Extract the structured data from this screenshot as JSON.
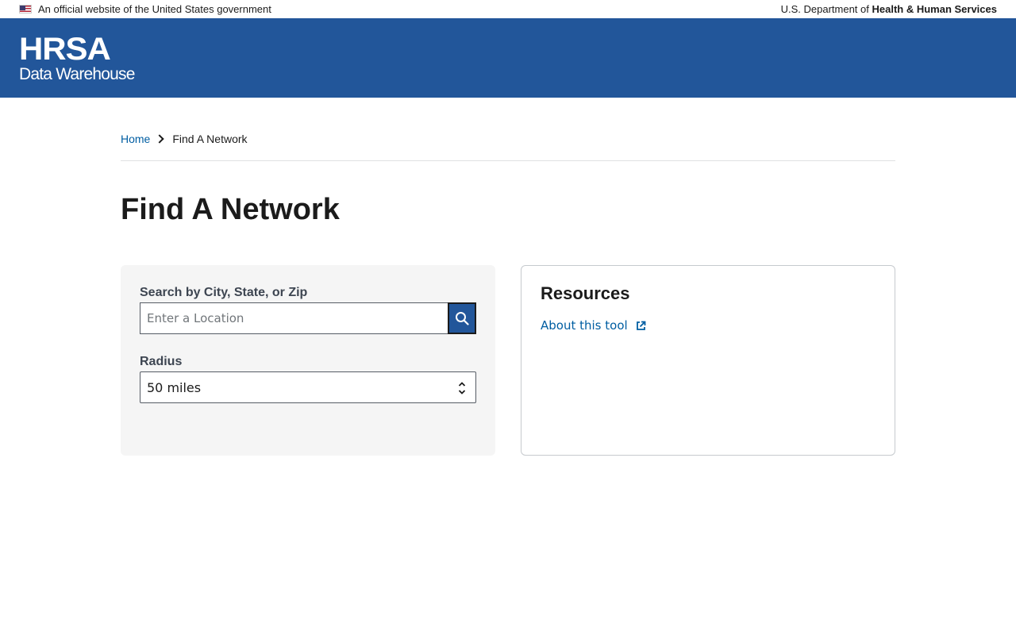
{
  "gov_banner": {
    "official_text": "An official website of the United States government",
    "dept_prefix": "U.S. Department of ",
    "dept_name": "Health & Human Services"
  },
  "header": {
    "logo_main": "HRSA",
    "logo_sub": "Data Warehouse",
    "background_color": "#22569a"
  },
  "breadcrumb": {
    "home": "Home",
    "current": "Find A Network"
  },
  "page": {
    "title": "Find A Network"
  },
  "search": {
    "label": "Search by City, State, or Zip",
    "placeholder": "Enter a Location",
    "value": "",
    "button_icon": "search-icon"
  },
  "radius": {
    "label": "Radius",
    "selected": "50 miles",
    "icon": "select-arrows-icon"
  },
  "resources": {
    "title": "Resources",
    "links": [
      {
        "label": "About this tool",
        "icon": "external-link-icon"
      }
    ]
  },
  "colors": {
    "link": "#005ea2",
    "primary": "#22569a"
  }
}
